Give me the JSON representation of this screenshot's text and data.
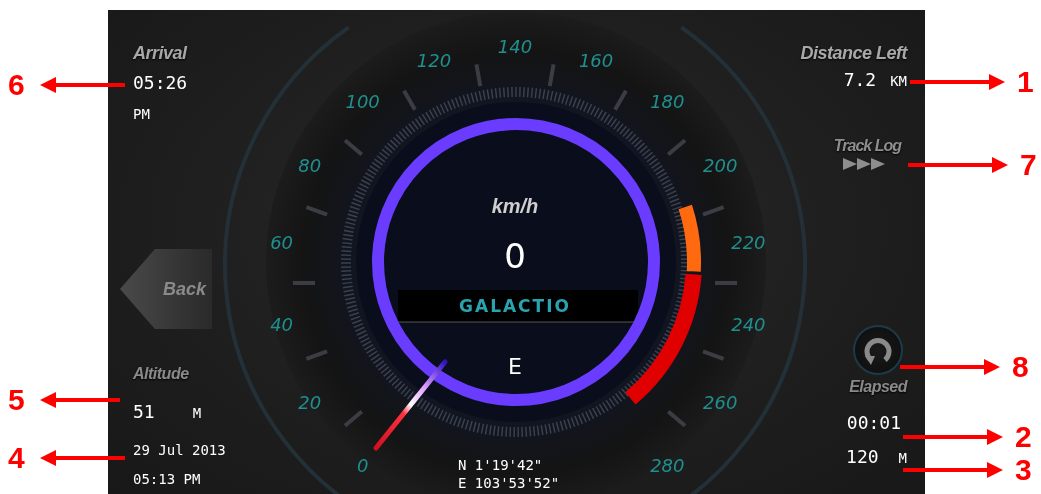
{
  "left_panel": {
    "arrival": {
      "label": "Arrival",
      "time": "05:26",
      "period": "PM"
    },
    "back_button": "Back",
    "altitude": {
      "label": "Altitude",
      "value": "51",
      "unit": "M"
    },
    "date": "29 Jul 2013",
    "time": "05:13 PM"
  },
  "gauge": {
    "scale": [
      "0",
      "20",
      "40",
      "60",
      "80",
      "100",
      "120",
      "140",
      "160",
      "180",
      "200",
      "220",
      "240",
      "260",
      "280"
    ],
    "unit": "km/h",
    "speed": "0",
    "brand": "GALACTIO",
    "heading": "E",
    "latitude": "N 1'19'42\"",
    "longitude": "E 103'53'52\""
  },
  "right_panel": {
    "distance_left": {
      "label": "Distance Left",
      "value": "7.2",
      "unit": "KM"
    },
    "track_log_button": "Track Log",
    "elapsed": {
      "label": "Elapsed",
      "time": "00:01",
      "distance": "120",
      "unit": "M"
    }
  },
  "callouts": [
    {
      "number": "6"
    },
    {
      "number": "5"
    },
    {
      "number": "4"
    },
    {
      "number": "1"
    },
    {
      "number": "7"
    },
    {
      "number": "8"
    },
    {
      "number": "2"
    },
    {
      "number": "3"
    }
  ]
}
